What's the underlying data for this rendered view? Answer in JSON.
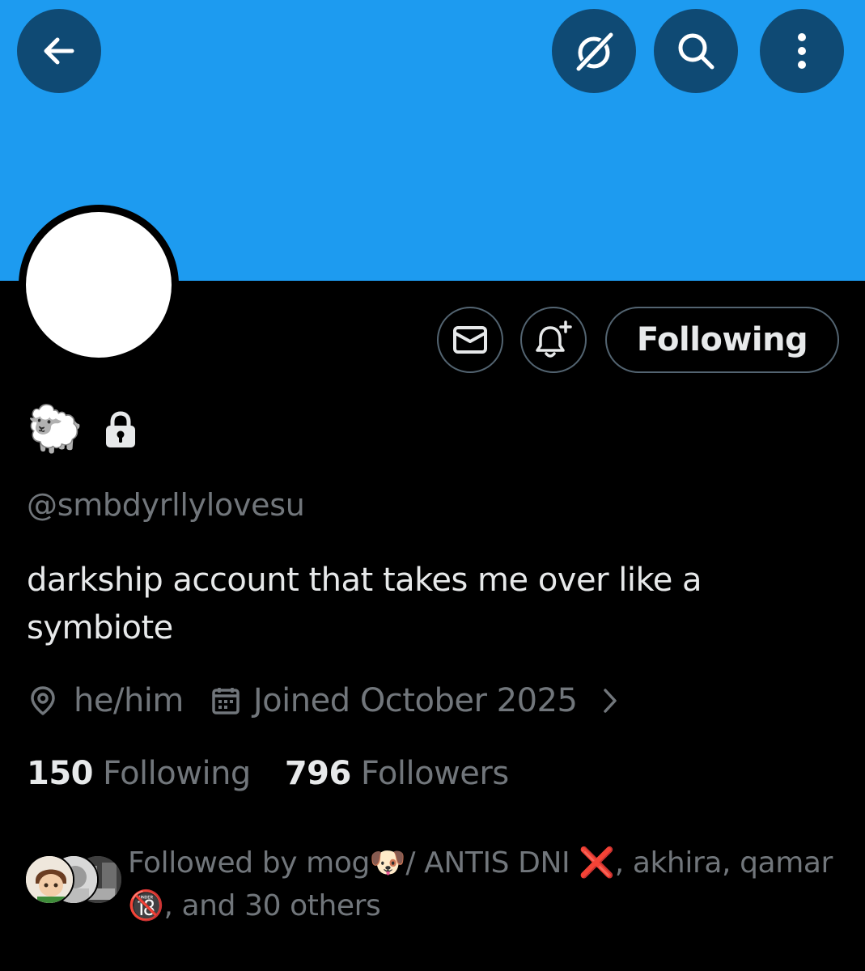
{
  "header": {
    "back_icon": "arrow-left-icon",
    "grok_icon": "grok-icon",
    "search_icon": "search-icon",
    "more_icon": "more-vertical-icon",
    "banner_color": "#1d9bf0"
  },
  "profile": {
    "display_name": "🐑",
    "protected_icon": "lock-icon",
    "handle": "@smbdyrllylovesu",
    "bio": "darkship account that takes me over like a symbiote",
    "location": "he/him",
    "joined": "Joined October 2025",
    "following_count": "150",
    "following_label": "Following",
    "followers_count": "796",
    "followers_label": "Followers"
  },
  "actions": {
    "message_icon": "envelope-icon",
    "notify_icon": "bell-plus-icon",
    "follow_button": "Following"
  },
  "followed_by": {
    "prefix": "Followed by ",
    "name1": "mog🐶/ ANTIS DNI ❌",
    "sep1": ", ",
    "name2": "akhira",
    "sep2": ", ",
    "name3": "qamar 🔞",
    "suffix": ", and 30 others"
  },
  "colors": {
    "accent": "#1d9bf0",
    "secondary_text": "#71767b",
    "primary_text": "#e7e9ea",
    "button_border": "#536471"
  }
}
